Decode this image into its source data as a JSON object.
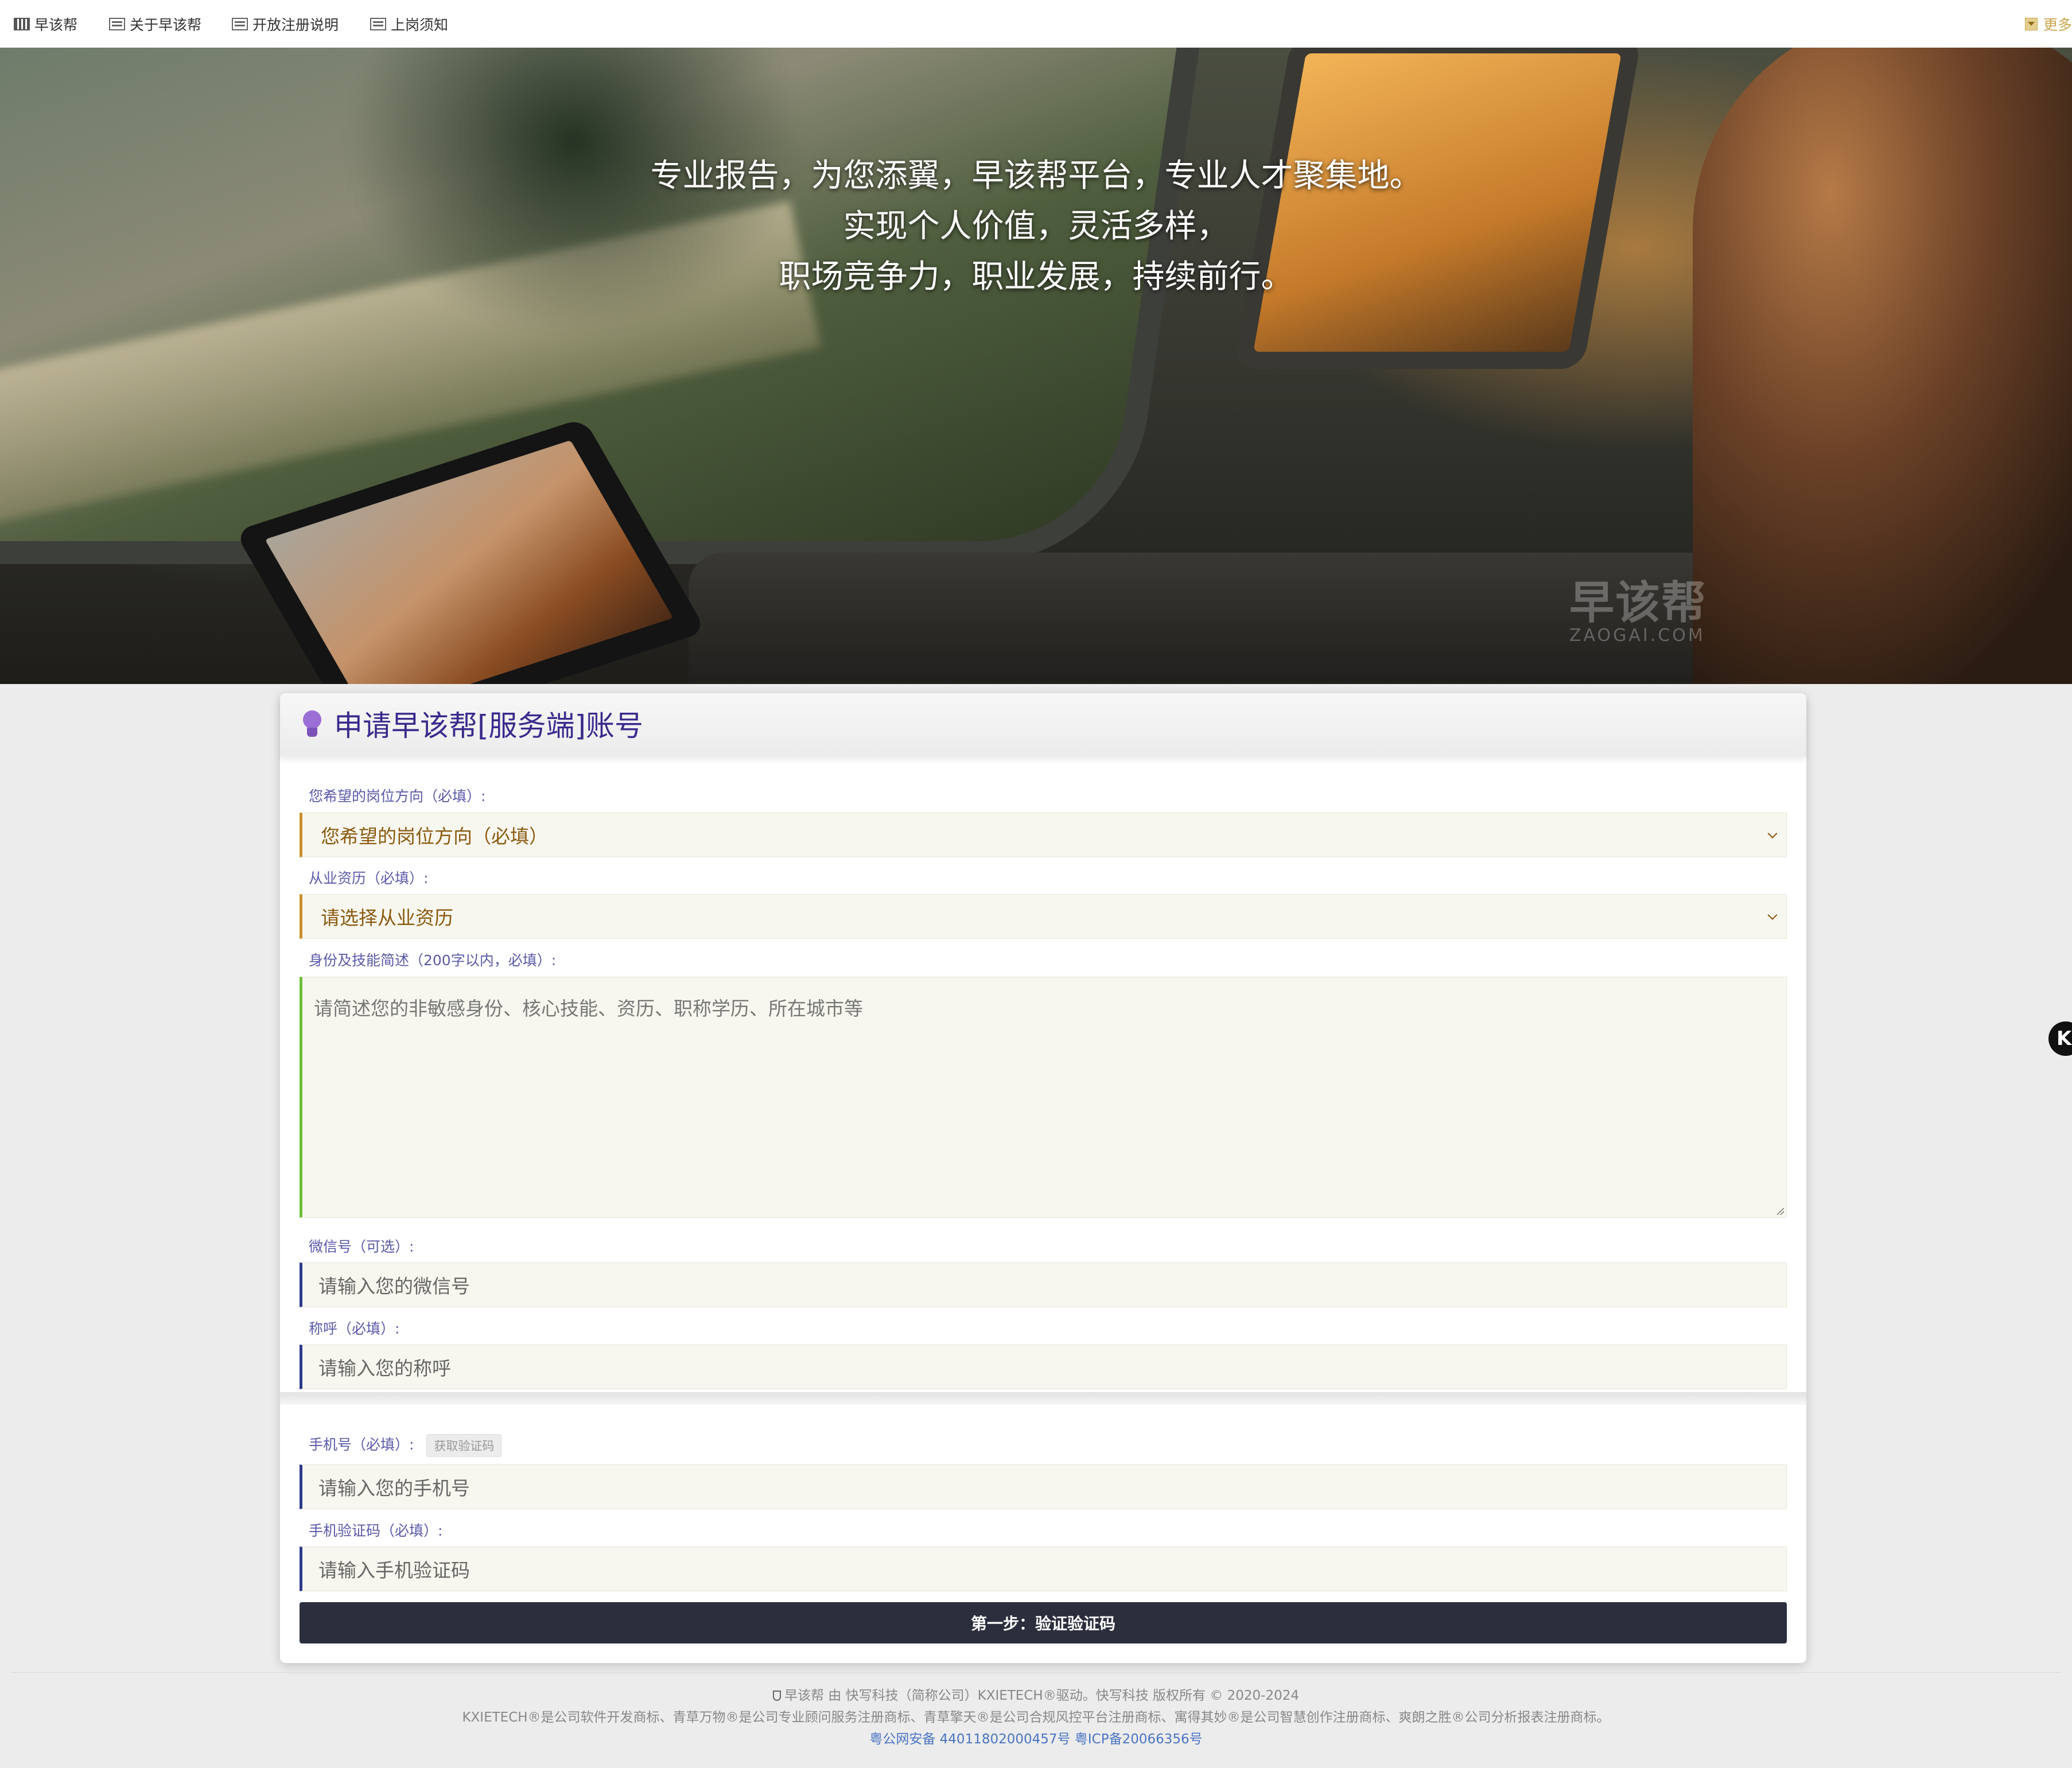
{
  "nav": {
    "items": [
      {
        "label": "早该帮",
        "icon": "grid-icon"
      },
      {
        "label": "关于早该帮",
        "icon": "document-icon"
      },
      {
        "label": "开放注册说明",
        "icon": "document-icon"
      },
      {
        "label": "上岗须知",
        "icon": "document-icon"
      }
    ],
    "more_label": "更多"
  },
  "hero": {
    "lines": [
      "专业报告，为您添翼，早该帮平台，专业人才聚集地。",
      "实现个人价值，灵活多样，",
      "职场竞争力，职业发展，持续前行。"
    ],
    "watermark_main": "早该帮",
    "watermark_sub": "ZAOGAI.COM"
  },
  "form": {
    "title": "申请早该帮[服务端]账号",
    "position": {
      "label": "您希望的岗位方向（必填）:",
      "selected": "您希望的岗位方向（必填）"
    },
    "experience": {
      "label": "从业资历（必填）:",
      "selected": "请选择从业资历"
    },
    "bio": {
      "label": "身份及技能简述（200字以内，必填）:",
      "placeholder": "请简述您的非敏感身份、核心技能、资历、职称学历、所在城市等"
    },
    "wechat": {
      "label": "微信号（可选）:",
      "placeholder": "请输入您的微信号"
    },
    "nickname": {
      "label": "称呼（必填）:",
      "placeholder": "请输入您的称呼"
    },
    "phone": {
      "label": "手机号（必填）:",
      "sms_button": "获取验证码",
      "placeholder": "请输入您的手机号"
    },
    "code": {
      "label": "手机验证码（必填）:",
      "placeholder": "请输入手机验证码"
    },
    "submit_label": "第一步：验证验证码"
  },
  "side_badge": "K",
  "footer": {
    "line1": "早该帮 由 快写科技（简称公司）KXIETECH®驱动。快写科技 版权所有 © 2020-2024",
    "line2": "KXIETECH®是公司软件开发商标、青草万物®是公司专业顾问服务注册商标、青草擎天®是公司合规风控平台注册商标、寓得其妙®是公司智慧创作注册商标、爽朗之胜®公司分析报表注册商标。",
    "police": "粤公网安备 44011802000457号",
    "icp": "粤ICP备20066356号"
  },
  "colors": {
    "title": "#3a2a8c",
    "label": "#5a5aa8",
    "select_accent": "#c8902a",
    "textarea_accent": "#6cc13a",
    "input_accent": "#2c3a8c",
    "submit_bg": "#2b2e3d"
  }
}
